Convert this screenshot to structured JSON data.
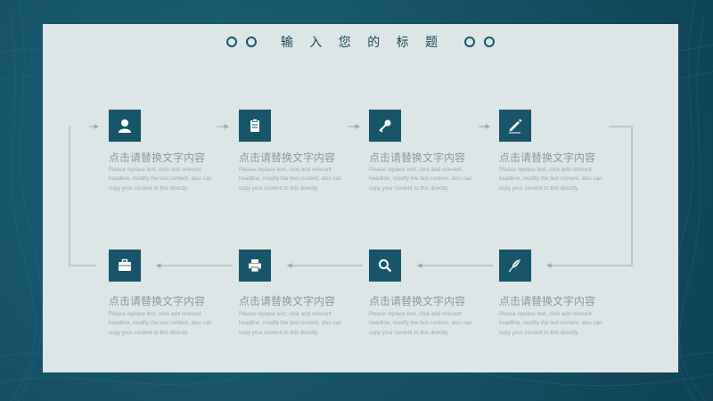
{
  "slide": {
    "title": "输 入 您 的 标 题"
  },
  "steps": [
    {
      "icon": "user-icon",
      "title": "点击请替换文字内容",
      "desc": "Please replace text, click add relevant headline, modify the text content, also can copy your content to this directly."
    },
    {
      "icon": "clipboard-icon",
      "title": "点击请替换文字内容",
      "desc": "Please replace text, click add relevant headline, modify the text content, also can copy your content to this directly."
    },
    {
      "icon": "key-icon",
      "title": "点击请替换文字内容",
      "desc": "Please replace text, click add relevant headline, modify the text content, also can copy your content to this directly."
    },
    {
      "icon": "pencil-icon",
      "title": "点击请替换文字内容",
      "desc": "Please replace text, click add relevant headline, modify the text content, also can copy your content to this directly."
    },
    {
      "icon": "briefcase-icon",
      "title": "点击请替换文字内容",
      "desc": "Please replace text, click add relevant headline, modify the text content, also can copy your content to this directly."
    },
    {
      "icon": "printer-icon",
      "title": "点击请替换文字内容",
      "desc": "Please replace text, click add relevant headline, modify the text content, also can copy your content to this directly."
    },
    {
      "icon": "search-icon",
      "title": "点击请替换文字内容",
      "desc": "Please replace text, click add relevant headline, modify the text content, also can copy your content to this directly."
    },
    {
      "icon": "quill-icon",
      "title": "点击请替换文字内容",
      "desc": "Please replace text, click add relevant headline, modify the text content, also can copy your content to this directly."
    }
  ],
  "colors": {
    "background": "#17556a",
    "panel": "#dde6e6",
    "accent": "#17556a",
    "text_muted": "#9aa7aa"
  }
}
